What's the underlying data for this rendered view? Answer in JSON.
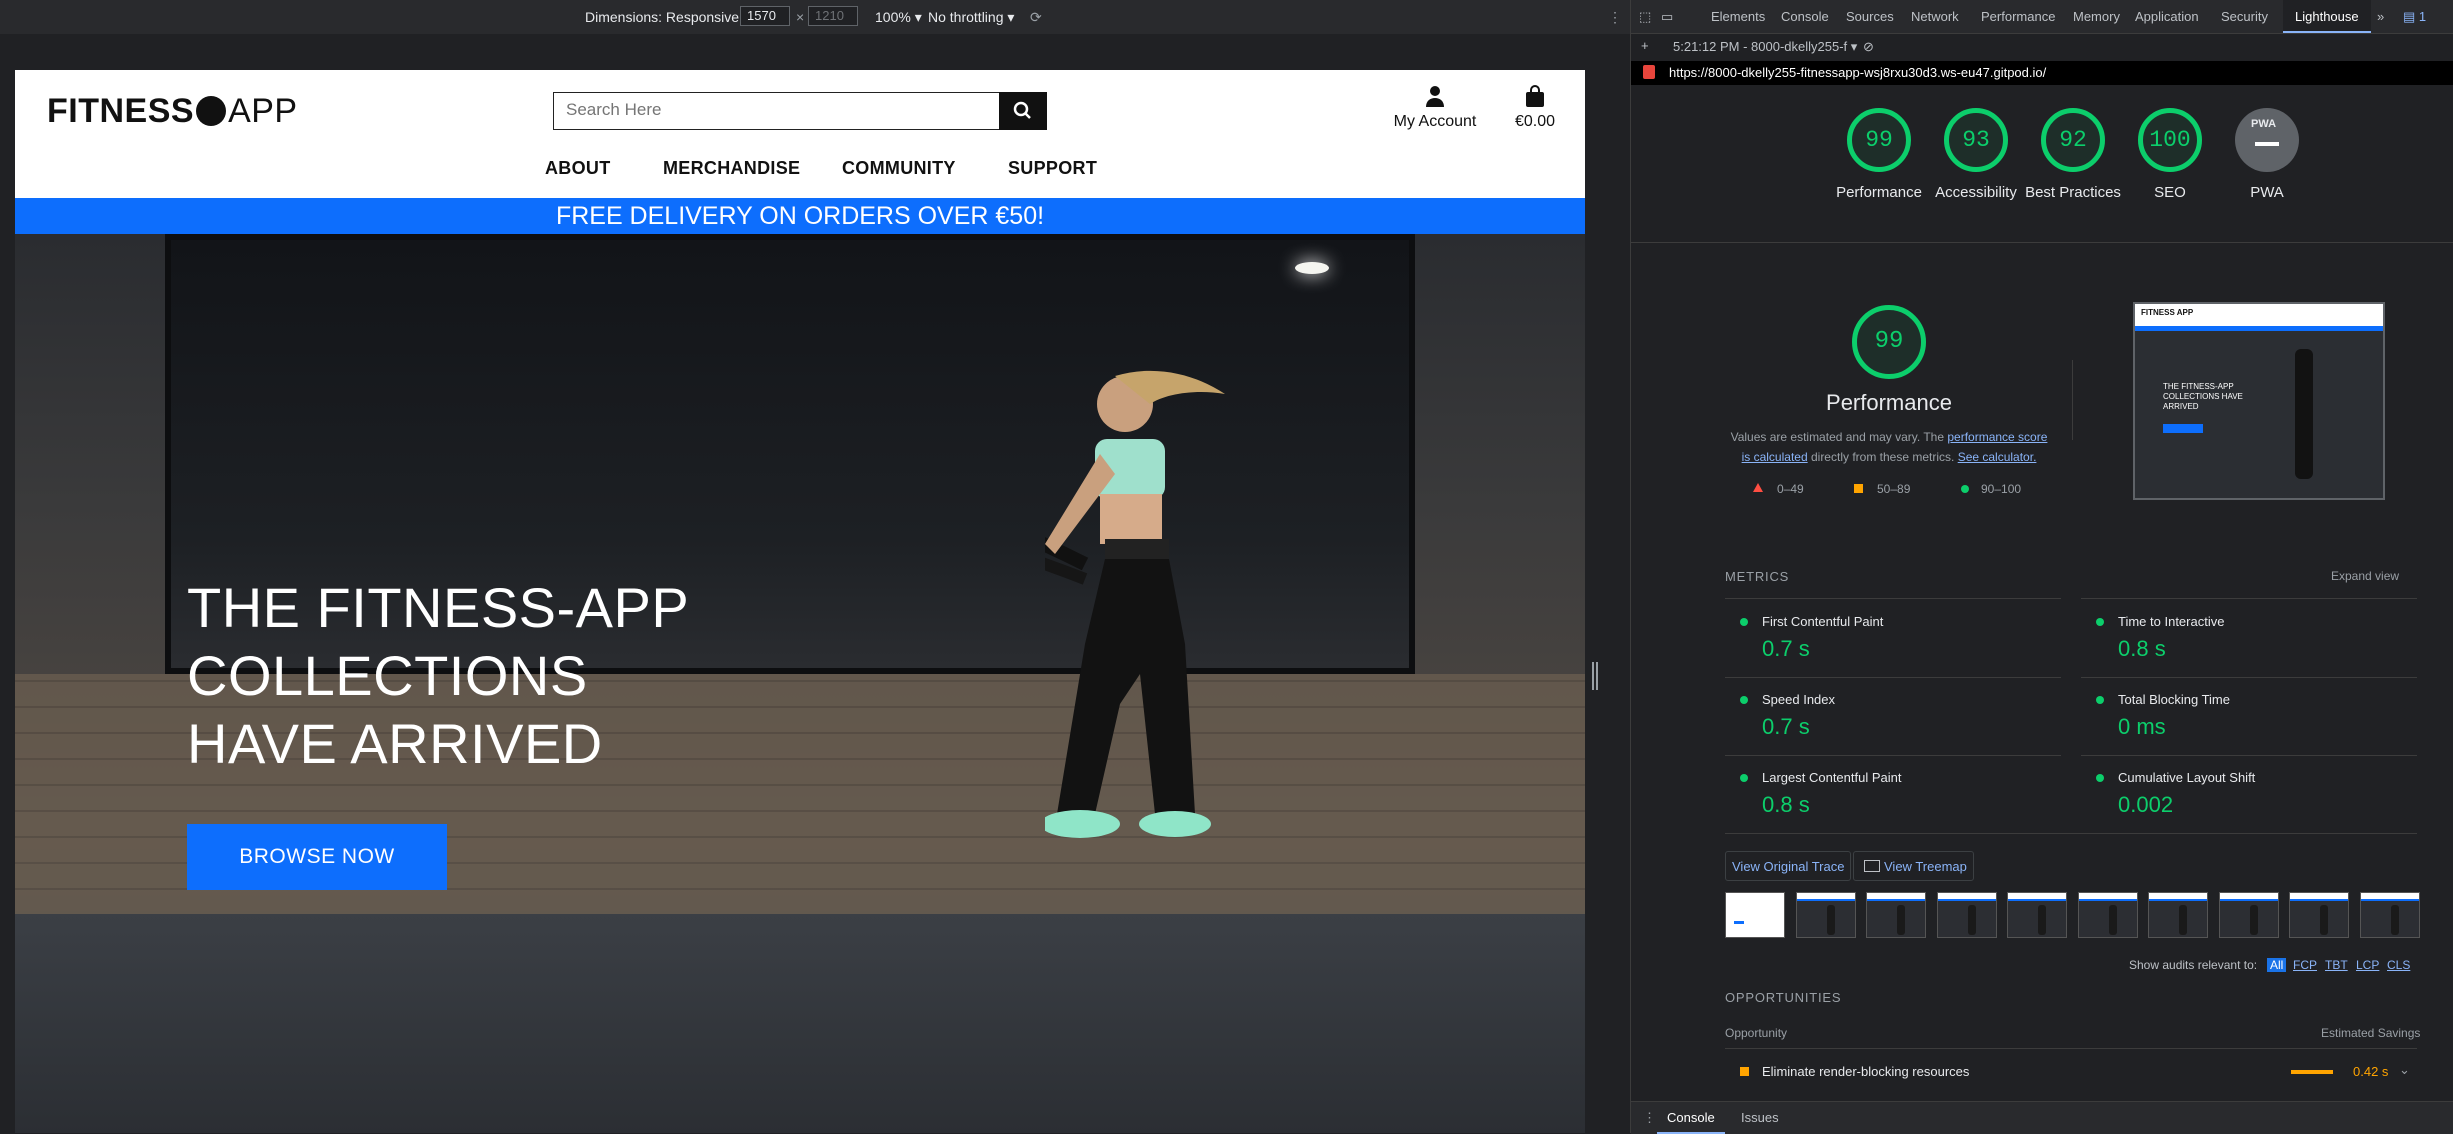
{
  "device_toolbar": {
    "dimensions_label": "Dimensions: Responsive",
    "width": "1570",
    "height": "1210",
    "times": "×",
    "zoom": "100%",
    "throttling": "No throttling"
  },
  "site": {
    "logo": {
      "word1": "FITNESS",
      "word2": "APP"
    },
    "search": {
      "placeholder": "Search Here"
    },
    "account_label": "My Account",
    "bag_total": "€0.00",
    "nav": [
      "ABOUT",
      "MERCHANDISE",
      "COMMUNITY",
      "SUPPORT"
    ],
    "banner": "FREE DELIVERY ON ORDERS OVER €50!",
    "hero": {
      "heading": "THE FITNESS-APP COLLECTIONS HAVE ARRIVED",
      "cta": "BROWSE NOW"
    }
  },
  "devtools": {
    "tabs": [
      "Elements",
      "Console",
      "Sources",
      "Network",
      "Performance",
      "Memory",
      "Application",
      "Security",
      "Lighthouse"
    ],
    "active_tab": "Lighthouse",
    "more_tabs": "»",
    "issues_count": "1",
    "report_selector": "5:21:12 PM - 8000-dkelly255-f",
    "url": "https://8000-dkelly255-fitnessapp-wsj8rxu30d3.ws-eu47.gitpod.io/",
    "scores": [
      {
        "label": "Performance",
        "value": "99"
      },
      {
        "label": "Accessibility",
        "value": "93"
      },
      {
        "label": "Best Practices",
        "value": "92"
      },
      {
        "label": "SEO",
        "value": "100"
      }
    ],
    "pwa_label": "PWA",
    "pwa_badge": "PWA",
    "perf": {
      "score": "99",
      "title": "Performance",
      "note_prefix": "Values are estimated and may vary. The ",
      "note_link1": "performance score is calculated",
      "note_middle": " directly from these metrics. ",
      "note_link2": "See calculator.",
      "legend": [
        "0–49",
        "50–89",
        "90–100"
      ]
    },
    "screenshot_thumb": {
      "logo": "FITNESS APP",
      "heading": "THE FITNESS-APP COLLECTIONS HAVE ARRIVED"
    },
    "metrics_title": "METRICS",
    "expand_view": "Expand view",
    "metrics": [
      {
        "label": "First Contentful Paint",
        "value": "0.7 s"
      },
      {
        "label": "Time to Interactive",
        "value": "0.8 s"
      },
      {
        "label": "Speed Index",
        "value": "0.7 s"
      },
      {
        "label": "Total Blocking Time",
        "value": "0 ms"
      },
      {
        "label": "Largest Contentful Paint",
        "value": "0.8 s"
      },
      {
        "label": "Cumulative Layout Shift",
        "value": "0.002"
      }
    ],
    "view_trace": "View Original Trace",
    "view_treemap": "View Treemap",
    "filter_label": "Show audits relevant to:",
    "filters": [
      "All",
      "FCP",
      "TBT",
      "LCP",
      "CLS"
    ],
    "opportunities_title": "OPPORTUNITIES",
    "opp_col1": "Opportunity",
    "opp_col2": "Estimated Savings",
    "opportunity": {
      "label": "Eliminate render-blocking resources",
      "savings": "0.42 s",
      "savings_fraction": 0.84
    },
    "drawer_tabs": [
      "Console",
      "Issues"
    ],
    "colors": {
      "pass": "#0cce6b",
      "average": "#ffa400",
      "fail": "#ff4e42",
      "link": "#8ab4f8",
      "accent": "#0d6efd"
    }
  }
}
